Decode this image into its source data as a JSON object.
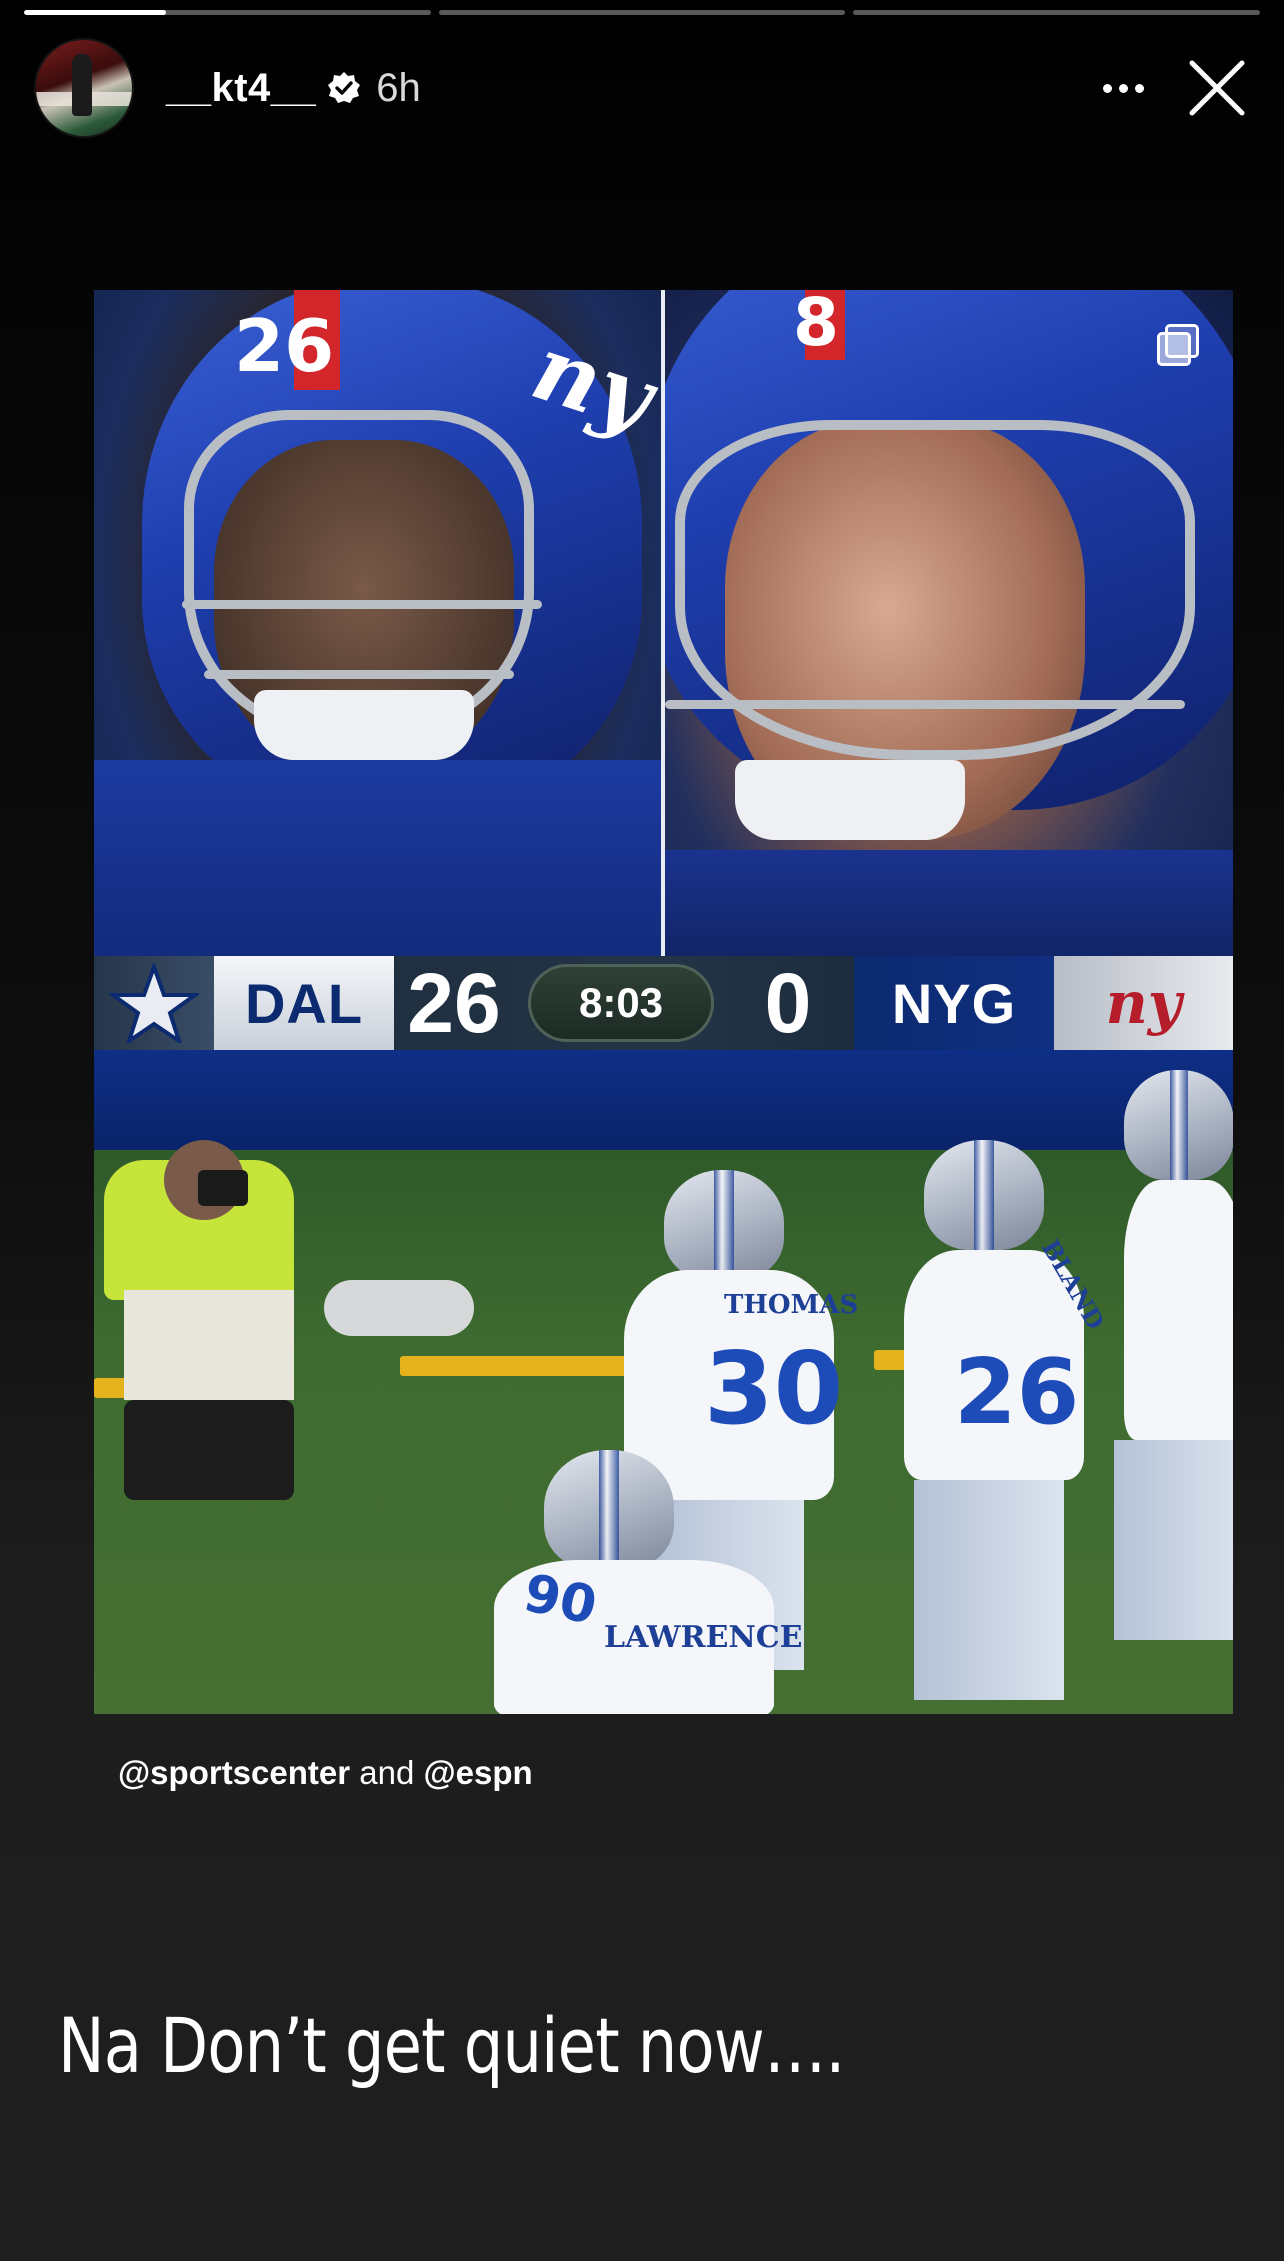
{
  "progress": {
    "segments": 3,
    "active_index": 0,
    "active_fill": 0.35
  },
  "header": {
    "username": "__kt4__",
    "verified": true,
    "time_ago": "6h",
    "more_icon": "more-horizontal-icon",
    "close_icon": "close-icon"
  },
  "shared_post": {
    "left_helmet_number": "26",
    "right_helmet_number": "8",
    "scorebug": {
      "away_team": "DAL",
      "away_score": "26",
      "clock": "8:03",
      "home_score": "0",
      "home_team": "NYG",
      "home_logo_text": "ny"
    },
    "players": {
      "thomas": {
        "name": "THOMAS",
        "number": "30"
      },
      "lawrence": {
        "name": "LAWRENCE",
        "number": "90"
      },
      "bland": {
        "name": "BLAND",
        "number": "26"
      }
    },
    "mentions": {
      "first": "@sportscenter",
      "joiner": "and",
      "second": "@espn"
    }
  },
  "story_text": "Na Don’t get quiet now….",
  "colors": {
    "giants_blue": "#1f3fb0",
    "giants_red": "#d3262b",
    "cowboys_navy": "#0b2a6f",
    "field_green": "#3e6b30"
  }
}
